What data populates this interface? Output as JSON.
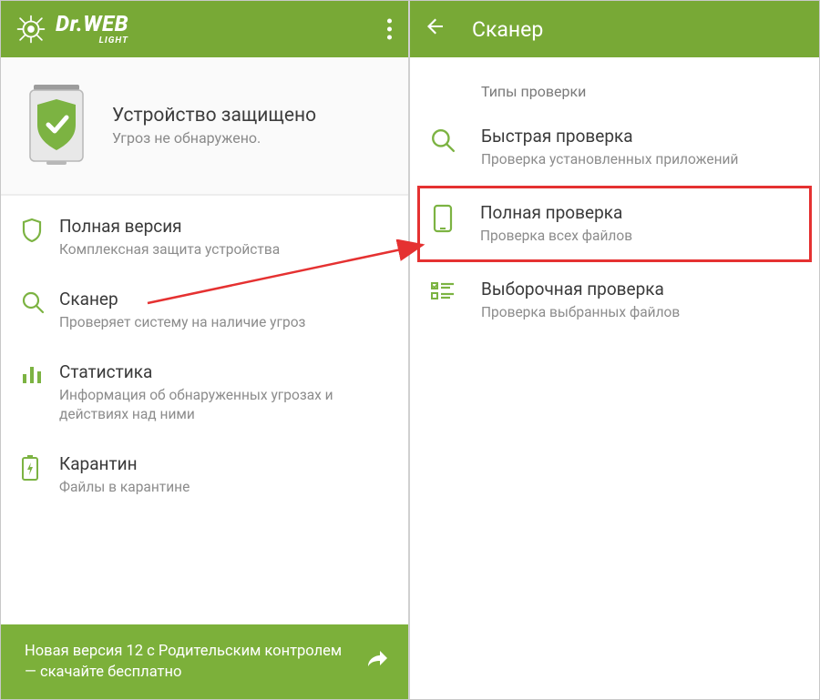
{
  "left": {
    "logo_main": "Dr.WEB",
    "logo_sub": "LIGHT",
    "status_title": "Устройство защищено",
    "status_sub": "Угроз не обнаружено.",
    "menu": [
      {
        "title": "Полная версия",
        "sub": "Комплексная защита устройства"
      },
      {
        "title": "Сканер",
        "sub": "Проверяет систему на наличие угроз"
      },
      {
        "title": "Статистика",
        "sub": "Информация об обнаруженных угрозах и действиях над ними"
      },
      {
        "title": "Карантин",
        "sub": "Файлы в карантине"
      }
    ],
    "banner": "Новая версия 12 с Родительским контролем — скачайте бесплатно"
  },
  "right": {
    "title": "Сканер",
    "section": "Типы проверки",
    "items": [
      {
        "title": "Быстрая проверка",
        "sub": "Проверка установленных приложений"
      },
      {
        "title": "Полная проверка",
        "sub": "Проверка всех файлов"
      },
      {
        "title": "Выборочная проверка",
        "sub": "Проверка выбранных файлов"
      }
    ]
  }
}
